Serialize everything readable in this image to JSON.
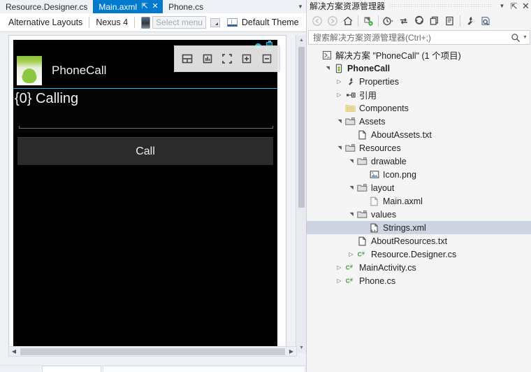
{
  "editor": {
    "tabs": [
      {
        "label": "Resource.Designer.cs",
        "active": false
      },
      {
        "label": "Main.axml",
        "active": true
      },
      {
        "label": "Phone.cs",
        "active": false
      }
    ],
    "tab_pin_icon": "pin-icon",
    "tab_close_icon": "close-icon",
    "tab_overflow_icon": "chevron-down-icon",
    "active_tab_color": "#007acc"
  },
  "designer_toolbar": {
    "alternative_layouts_label": "Alternative Layouts",
    "device_label": "Nexus 4",
    "orientation_icon": "phone-portrait-icon",
    "select_menu_placeholder": "Select menu",
    "select_menu_dropdown_icon": "dropdown-icon",
    "theme_icon": "theme-icon",
    "theme_label": "Default Theme"
  },
  "designer_overlay": {
    "buttons": [
      {
        "name": "split-view-icon",
        "title": "Split view"
      },
      {
        "name": "properties-panel-icon",
        "title": "Properties"
      },
      {
        "name": "fullscreen-icon",
        "title": "Full screen"
      },
      {
        "name": "zoom-in-icon",
        "title": "Zoom in"
      },
      {
        "name": "zoom-out-icon",
        "title": "Zoom out"
      }
    ]
  },
  "preview": {
    "status_bar": {
      "wifi_icon": "wifi-icon",
      "battery_icon": "battery-icon",
      "accent_color": "#33b5e5"
    },
    "app_bar": {
      "app_icon": "android-app-icon",
      "app_title": "PhoneCall",
      "divider_color": "#33b5e5"
    },
    "edit_text_value": "{0} Calling",
    "call_button_label": "Call",
    "background_color": "#000000"
  },
  "designer_scroll": {
    "v_up_icon": "scroll-up-arrow-icon",
    "v_down_icon": "scroll-down-arrow-icon",
    "h_left_icon": "scroll-left-arrow-icon",
    "h_right_icon": "scroll-right-arrow-icon"
  },
  "solution_explorer": {
    "title": "解决方案资源管理器",
    "title_buttons": [
      {
        "name": "window-dropdown-icon",
        "glyph": "▼"
      },
      {
        "name": "pin-icon",
        "glyph": "⇱"
      },
      {
        "name": "close-icon",
        "glyph": "✕"
      }
    ],
    "toolbar_icons": [
      {
        "name": "back-navigate-icon",
        "disabled": true
      },
      {
        "name": "forward-navigate-icon",
        "disabled": true
      },
      {
        "name": "home-icon",
        "disabled": false
      },
      {
        "name": "sync-with-active-document-icon",
        "disabled": false
      },
      {
        "name": "pending-changes-filter-icon",
        "disabled": false
      },
      {
        "name": "refresh-icon",
        "disabled": false
      },
      {
        "name": "collapse-all-icon",
        "disabled": false
      },
      {
        "name": "show-all-files-icon",
        "disabled": false
      },
      {
        "name": "properties-icon",
        "disabled": false
      },
      {
        "name": "preview-selected-items-icon",
        "disabled": false
      }
    ],
    "search": {
      "placeholder": "搜索解决方案资源管理器(Ctrl+;)",
      "value": "",
      "search_icon": "search-icon",
      "dropdown_icon": "search-options-dropdown-icon"
    },
    "tree": [
      {
        "label": "解决方案 \"PhoneCall\" (1 个项目)",
        "indent": 0,
        "twisty": "",
        "icon": "solution-icon",
        "bold": false,
        "selected": false
      },
      {
        "label": "PhoneCall",
        "indent": 1,
        "twisty": "expanded",
        "icon": "android-project-icon",
        "bold": true,
        "selected": false
      },
      {
        "label": "Properties",
        "indent": 2,
        "twisty": "collapsed",
        "icon": "wrench-icon",
        "bold": false,
        "selected": false
      },
      {
        "label": "引用",
        "indent": 2,
        "twisty": "collapsed",
        "icon": "references-icon",
        "bold": false,
        "selected": false
      },
      {
        "label": "Components",
        "indent": 2,
        "twisty": "",
        "icon": "components-folder-icon",
        "bold": false,
        "selected": false
      },
      {
        "label": "Assets",
        "indent": 2,
        "twisty": "expanded",
        "icon": "folder-icon",
        "bold": false,
        "selected": false
      },
      {
        "label": "AboutAssets.txt",
        "indent": 3,
        "twisty": "",
        "icon": "text-file-icon",
        "bold": false,
        "selected": false
      },
      {
        "label": "Resources",
        "indent": 2,
        "twisty": "expanded",
        "icon": "folder-icon",
        "bold": false,
        "selected": false
      },
      {
        "label": "drawable",
        "indent": 3,
        "twisty": "expanded",
        "icon": "folder-icon",
        "bold": false,
        "selected": false
      },
      {
        "label": "Icon.png",
        "indent": 4,
        "twisty": "",
        "icon": "image-file-icon",
        "bold": false,
        "selected": false
      },
      {
        "label": "layout",
        "indent": 3,
        "twisty": "expanded",
        "icon": "folder-icon",
        "bold": false,
        "selected": false
      },
      {
        "label": "Main.axml",
        "indent": 4,
        "twisty": "",
        "icon": "axml-file-icon",
        "bold": false,
        "selected": false
      },
      {
        "label": "values",
        "indent": 3,
        "twisty": "expanded",
        "icon": "folder-icon",
        "bold": false,
        "selected": false
      },
      {
        "label": "Strings.xml",
        "indent": 4,
        "twisty": "",
        "icon": "xml-file-icon",
        "bold": false,
        "selected": true
      },
      {
        "label": "AboutResources.txt",
        "indent": 3,
        "twisty": "",
        "icon": "text-file-icon",
        "bold": false,
        "selected": false
      },
      {
        "label": "Resource.Designer.cs",
        "indent": 3,
        "twisty": "collapsed",
        "icon": "csharp-file-icon",
        "bold": false,
        "selected": false
      },
      {
        "label": "MainActivity.cs",
        "indent": 2,
        "twisty": "collapsed",
        "icon": "csharp-file-icon",
        "bold": false,
        "selected": false
      },
      {
        "label": "Phone.cs",
        "indent": 2,
        "twisty": "collapsed",
        "icon": "csharp-file-icon",
        "bold": false,
        "selected": false
      }
    ],
    "selection_color": "#cdd3e1"
  }
}
